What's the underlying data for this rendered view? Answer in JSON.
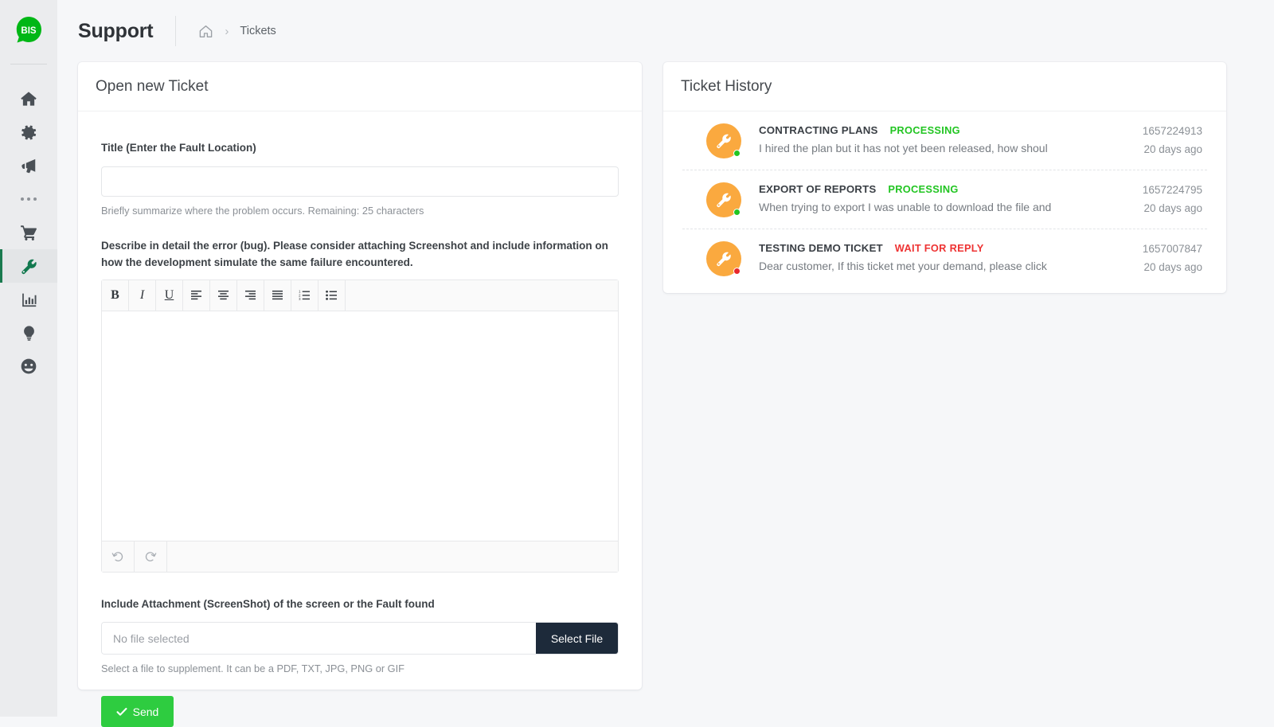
{
  "brand": {
    "logo_text": "BIS",
    "logo_color": "#00b715"
  },
  "header": {
    "title": "Support",
    "breadcrumb": {
      "home_icon": "home-icon",
      "separator": "›",
      "current": "Tickets"
    }
  },
  "sidebar": {
    "items": [
      {
        "icon": "home-icon",
        "active": false
      },
      {
        "icon": "gear-icon",
        "active": false
      },
      {
        "icon": "megaphone-icon",
        "active": false
      },
      {
        "icon": "ellipsis-icon",
        "active": false
      },
      {
        "icon": "shopping-cart-icon",
        "active": false
      },
      {
        "icon": "wrench-icon",
        "active": true
      },
      {
        "icon": "chart-bar-icon",
        "active": false
      },
      {
        "icon": "lightbulb-icon",
        "active": false
      },
      {
        "icon": "smiley-icon",
        "active": false
      }
    ],
    "active_accent": "#1a7a4f"
  },
  "form_card": {
    "title": "Open new Ticket",
    "title_field": {
      "label": "Title (Enter the Fault Location)",
      "value": "",
      "placeholder": "",
      "help": "Briefly summarize where the problem occurs. Remaining: 25 characters"
    },
    "description_field": {
      "label": "Describe in detail the error (bug). Please consider attaching Screenshot and include information on how the development simulate the same failure encountered.",
      "value": "",
      "toolbar": [
        {
          "name": "bold-button",
          "glyph": "B"
        },
        {
          "name": "italic-button",
          "glyph": "I"
        },
        {
          "name": "underline-button",
          "glyph": "U"
        },
        {
          "name": "align-left-button",
          "glyph": "align-left-icon"
        },
        {
          "name": "align-center-button",
          "glyph": "align-center-icon"
        },
        {
          "name": "align-right-button",
          "glyph": "align-right-icon"
        },
        {
          "name": "align-justify-button",
          "glyph": "align-justify-icon"
        },
        {
          "name": "ordered-list-button",
          "glyph": "ordered-list-icon"
        },
        {
          "name": "unordered-list-button",
          "glyph": "unordered-list-icon"
        }
      ],
      "footer": [
        {
          "name": "undo-button",
          "glyph": "undo-icon"
        },
        {
          "name": "redo-button",
          "glyph": "redo-icon"
        }
      ]
    },
    "attachment_field": {
      "label": "Include Attachment (ScreenShot) of the screen or the Fault found",
      "file_name": "No file selected",
      "button_label": "Select File",
      "help": "Select a file to supplement. It can be a PDF, TXT, JPG, PNG or GIF"
    },
    "submit": {
      "label": "Send",
      "icon": "check-icon",
      "color": "#2ecc40"
    }
  },
  "history_card": {
    "title": "Ticket History",
    "tickets": [
      {
        "avatar_icon": "wrench-icon",
        "subject": "CONTRACTING PLANS",
        "status": "PROCESSING",
        "status_color": "#22c522",
        "dot_color": "#22c522",
        "preview": "I hired the plan but it has not yet been released, how shoul",
        "id": "1657224913",
        "age": "20 days ago"
      },
      {
        "avatar_icon": "wrench-icon",
        "subject": "EXPORT OF REPORTS",
        "status": "PROCESSING",
        "status_color": "#22c522",
        "dot_color": "#22c522",
        "preview": "When trying to export I was unable to download the file and",
        "id": "1657224795",
        "age": "20 days ago"
      },
      {
        "avatar_icon": "wrench-icon",
        "subject": "TESTING DEMO TICKET",
        "status": "WAIT FOR REPLY",
        "status_color": "#ee3333",
        "dot_color": "#e8272c",
        "preview": "Dear customer, If this ticket met your demand, please click",
        "id": "1657007847",
        "age": "20 days ago"
      }
    ]
  }
}
